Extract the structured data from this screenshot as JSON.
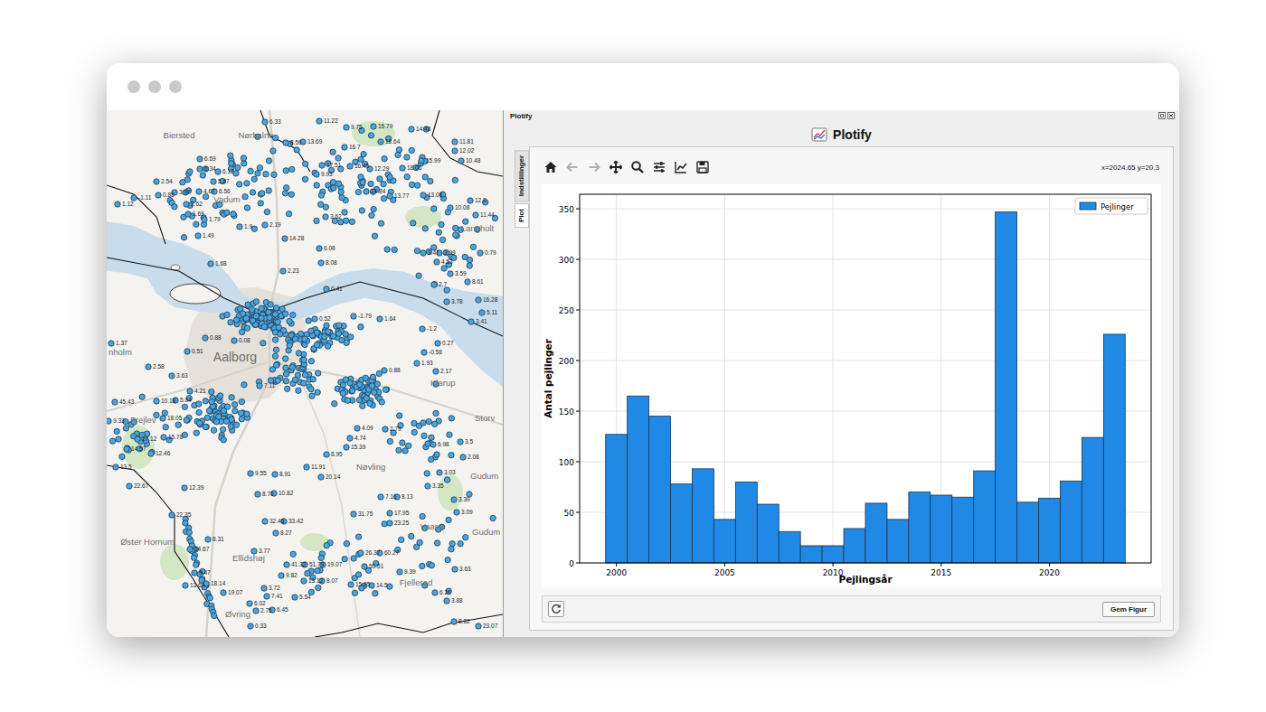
{
  "map": {
    "places": [
      "Biersted",
      "Nørhalne",
      "Vadum",
      "Langholt",
      "nholm",
      "Aalborg",
      "Klarup",
      "Frejlev",
      "Storv",
      "Nøvling",
      "Gudum",
      "Vaarst",
      "Gudum",
      "Øster Hornum",
      "Ellidshøj",
      "Fjellerad",
      "Øvring"
    ],
    "point_labels": [
      "6.33",
      "11.22",
      "9.75",
      "15.79",
      "14.48",
      "8.59",
      "13.69",
      "16.7",
      "18.64",
      "11.81",
      "12.02",
      "6.69",
      "6.34",
      "6.12",
      "5.87",
      "2.54",
      "0.88",
      "3.97",
      "4.67",
      "6.56",
      "17.51",
      "16.45",
      "12.29",
      "18.06",
      "15.99",
      "10.48",
      "1.12",
      "-1.11",
      "2.62",
      "1.69",
      "1.79",
      "9.93",
      "14.84",
      "13.77",
      "13.08",
      "3.62",
      "10.08",
      "12.3",
      "11.44",
      "1.49",
      "1.9",
      "2.19",
      "14.28",
      "3.47",
      "3.99",
      "0.79",
      "1.68",
      "6.08",
      "8.08",
      "4.53",
      "2.23",
      "3.59",
      "8.61",
      "2.7",
      "3.78",
      "16.28",
      "5.11",
      "3.41",
      "0.41",
      "0.52",
      "-1.79",
      "1.64",
      "1.37",
      "2.58",
      "3.63",
      "0.51",
      "0.88",
      "0.08",
      "0.88",
      "-0.58",
      "1.93",
      "2.17",
      "-1.2",
      "0.27",
      "4.21",
      "10.18",
      "5.04",
      "45.43",
      "9.33",
      "18.05",
      "17.12",
      "15.78",
      "14.57",
      "12.46",
      "13.5",
      "22.67",
      "12.39",
      "22.35",
      "7.11",
      "4.09",
      "2.79",
      "4.74",
      "15.39",
      "8.95",
      "11.91",
      "20.14",
      "6.98",
      "3.5",
      "2.08",
      "3.03",
      "3.35",
      "3.39",
      "3.09",
      "7.16",
      "8.13",
      "9.55",
      "8.91",
      "8.76",
      "10.82",
      "32.46",
      "33.42",
      "8.27",
      "31.75",
      "17.95",
      "23.25",
      "26.37",
      "60.27",
      "50.51",
      "9.39",
      "41.32",
      "51.79",
      "19.07",
      "9.82",
      "13.12",
      "8.07",
      "54.67",
      "8.31",
      "3.77",
      "9.47",
      "13.69",
      "18.14",
      "19.07",
      "15.95",
      "14.5",
      "3.63",
      "6.26",
      "3.88",
      "8.82",
      "23.07",
      "3.72",
      "7.41",
      "6.02",
      "2.75",
      "6.45",
      "5.54",
      "0.33"
    ]
  },
  "panel": {
    "dock_title": "Plotify",
    "header": "Plotify"
  },
  "tabs": [
    {
      "label": "Indstillinger",
      "selected": false
    },
    {
      "label": "Plot",
      "selected": true
    }
  ],
  "toolbar": {
    "tools": [
      {
        "kind": "home",
        "disabled": false
      },
      {
        "kind": "back",
        "disabled": true
      },
      {
        "kind": "forward",
        "disabled": true
      },
      {
        "kind": "pan",
        "disabled": false
      },
      {
        "kind": "zoom",
        "disabled": false
      },
      {
        "kind": "configure",
        "disabled": false
      },
      {
        "kind": "edit",
        "disabled": false
      },
      {
        "kind": "save",
        "disabled": false
      }
    ],
    "coordinates": "x=2024.65 y=20.3"
  },
  "chart": {
    "y_label": "Antal pejlinger",
    "x_label": "Pejlingsår",
    "y_ticks": [
      "0",
      "50",
      "100",
      "150",
      "200",
      "250",
      "300",
      "350"
    ],
    "x_ticks": [
      "2000",
      "2005",
      "2010",
      "2015",
      "2020"
    ],
    "series": [
      {
        "name": "Pejlinger",
        "years": [
          2000,
          2001,
          2002,
          2003,
          2004,
          2005,
          2006,
          2007,
          2008,
          2009,
          2010,
          2011,
          2012,
          2013,
          2014,
          2015,
          2016,
          2017,
          2018,
          2019,
          2020,
          2021,
          2022,
          2023
        ],
        "values": [
          127,
          165,
          145,
          78,
          93,
          43,
          80,
          58,
          31,
          17,
          17,
          34,
          59,
          43,
          70,
          67,
          65,
          91,
          347,
          60,
          64,
          81,
          124,
          226
        ]
      }
    ]
  },
  "buttons": {
    "save": "Gem Figur"
  }
}
